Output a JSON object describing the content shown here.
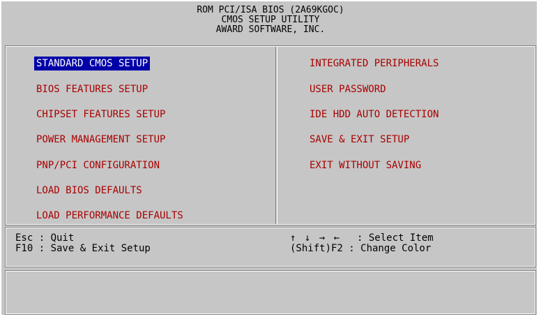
{
  "header": {
    "line1": "ROM PCI/ISA BIOS (2A69KGOC)",
    "line2": "CMOS SETUP UTILITY",
    "line3": "AWARD SOFTWARE, INC."
  },
  "menu": {
    "left": [
      {
        "label": "STANDARD CMOS SETUP",
        "selected": true
      },
      {
        "label": "BIOS FEATURES SETUP"
      },
      {
        "label": "CHIPSET FEATURES SETUP"
      },
      {
        "label": "POWER MANAGEMENT SETUP"
      },
      {
        "label": "PNP/PCI CONFIGURATION"
      },
      {
        "label": "LOAD BIOS DEFAULTS"
      },
      {
        "label": "LOAD PERFORMANCE DEFAULTS"
      }
    ],
    "right": [
      {
        "label": "INTEGRATED PERIPHERALS"
      },
      {
        "label": "USER PASSWORD"
      },
      {
        "label": "IDE HDD AUTO DETECTION"
      },
      {
        "label": "SAVE & EXIT SETUP"
      },
      {
        "label": "EXIT WITHOUT SAVING"
      }
    ]
  },
  "help": {
    "quit": "Esc : Quit",
    "save_exit": "F10 : Save & Exit Setup",
    "arrows": "↑ ↓ → ←",
    "select_item": ": Select Item",
    "change_color": "(Shift)F2 : Change Color"
  },
  "colors": {
    "background": "#c6c6c6",
    "item_text": "#a80000",
    "highlight_bg": "#0000a8",
    "highlight_text": "#ffffff"
  }
}
